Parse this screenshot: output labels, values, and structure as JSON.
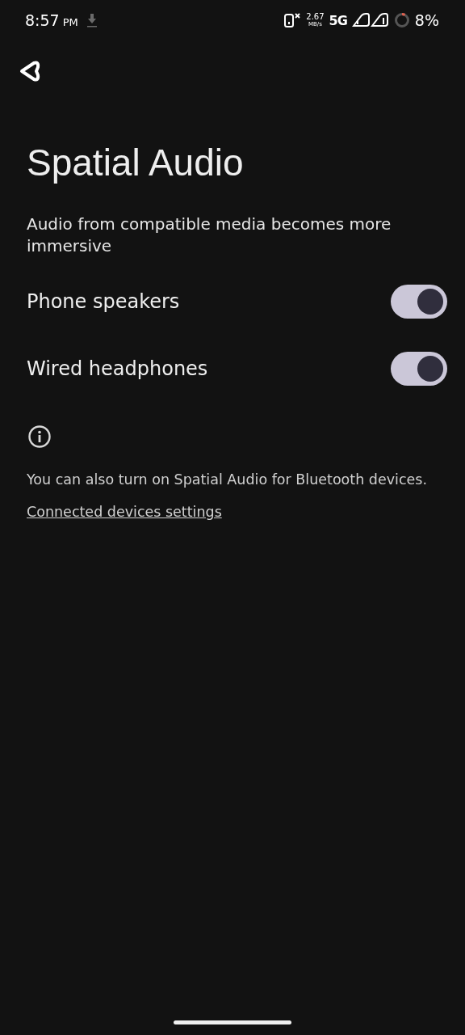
{
  "status_bar": {
    "time": "8:57",
    "ampm": "PM",
    "speed_value": "2.67",
    "speed_unit": "MB/s",
    "network": "5G",
    "battery": "8%"
  },
  "title": "Spatial Audio",
  "description": "Audio from compatible media becomes more immersive",
  "toggles": [
    {
      "label": "Phone speakers",
      "on": true
    },
    {
      "label": "Wired headphones",
      "on": true
    }
  ],
  "footer": {
    "text": "You can also turn on Spatial Audio for Bluetooth devices.",
    "link": "Connected devices settings"
  }
}
